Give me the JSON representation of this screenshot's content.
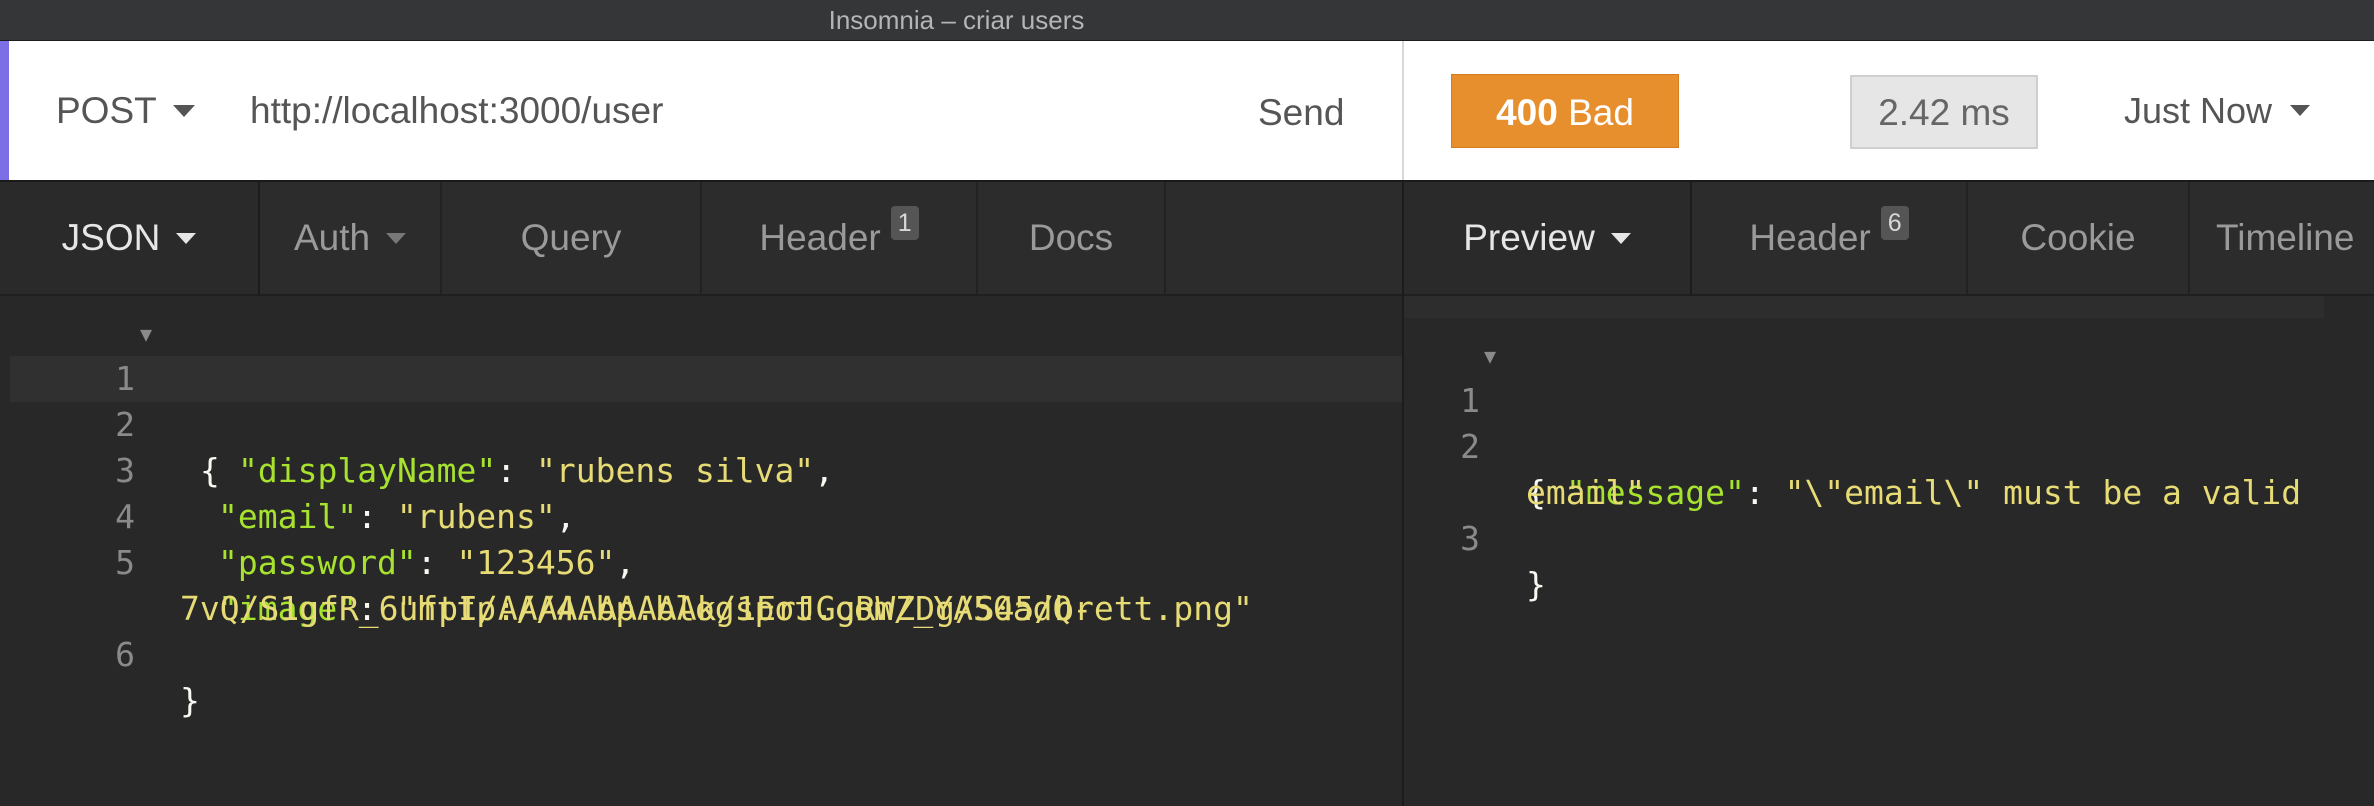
{
  "window": {
    "title": "Insomnia – criar users"
  },
  "request": {
    "method": "POST",
    "url": "http://localhost:3000/user",
    "send_label": "Send",
    "tabs": [
      {
        "label": "JSON"
      },
      {
        "label": "Auth"
      },
      {
        "label": "Query"
      },
      {
        "label": "Header",
        "count": "1"
      },
      {
        "label": "Docs"
      }
    ],
    "body_lines": [
      {
        "num": "1",
        "brace": "{"
      },
      {
        "num": "2",
        "key": "\"displayName\"",
        "value": "\"rubens silva\""
      },
      {
        "num": "3",
        "key": "\"email\"",
        "value": "\"rubens\""
      },
      {
        "num": "4",
        "key": "\"password\"",
        "value": "\"123456\""
      },
      {
        "num": "5",
        "key": "\"image\"",
        "value": "\"http://4.bp.blogspot.com/_YA50adQ-",
        "value_cont": "7vQ/S1gfR_6ufpI/AAAAAAAAAAk/1ErJGgRWZDg/S45/brett.png\""
      },
      {
        "num": "6",
        "brace": "}"
      }
    ]
  },
  "response": {
    "status_code": "400",
    "status_text": "Bad Request",
    "time": "2.42 ms",
    "when": "Just Now",
    "tabs": [
      {
        "label": "Preview"
      },
      {
        "label": "Header",
        "count": "6"
      },
      {
        "label": "Cookie"
      },
      {
        "label": "Timeline"
      }
    ],
    "body_lines": [
      {
        "num": "1",
        "brace": "{"
      },
      {
        "num": "2",
        "key": "\"message\"",
        "value": "\"\\\"email\\\" must be a valid",
        "value_cont": "email\""
      },
      {
        "num": "3",
        "brace": "}"
      }
    ]
  },
  "colors": {
    "accent": "#7c6ee6",
    "status_warning": "#e88f2d",
    "json_key": "#a6e22e",
    "json_string": "#e6db74"
  }
}
